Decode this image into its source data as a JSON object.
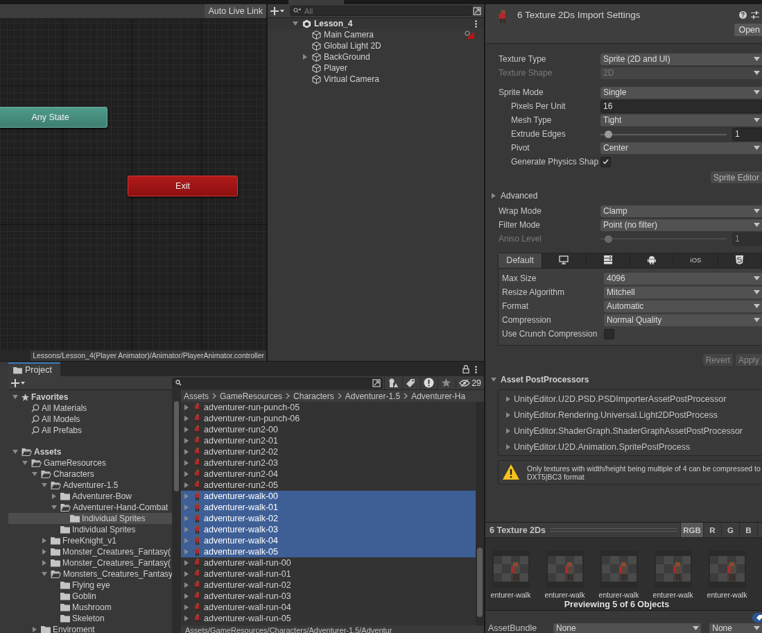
{
  "animator": {
    "toolbar_button": "Auto Live Link",
    "nodes": [
      {
        "label": "Any State",
        "kind": "any_state"
      },
      {
        "label": "Exit",
        "kind": "exit"
      }
    ],
    "path": "Lessons/Lesson_4(Player Animator)/Animator/PlayerAnimator.controller"
  },
  "hierarchy": {
    "search": {
      "placeholder": "All"
    },
    "scene": {
      "label": "Lesson_4",
      "expanded": true
    },
    "items": [
      {
        "label": "Main Camera",
        "expandable": false,
        "alert": true
      },
      {
        "label": "Global Light 2D",
        "expandable": false,
        "alert": false
      },
      {
        "label": "BackGround",
        "expandable": true,
        "alert": false
      },
      {
        "label": "Player",
        "expandable": false,
        "alert": false
      },
      {
        "label": "Virtual Camera",
        "expandable": false,
        "alert": false
      }
    ]
  },
  "inspector": {
    "title": "6 Texture 2Ds Import Settings",
    "open_button": "Open",
    "texture_rows": [
      {
        "label": "Texture Type",
        "kind": "dropdown",
        "value": "Sprite (2D and UI)",
        "disabled": false
      },
      {
        "label": "Texture Shape",
        "kind": "dropdown",
        "value": "2D",
        "disabled": true
      }
    ],
    "sprite_rows": [
      {
        "label": "Sprite Mode",
        "kind": "dropdown",
        "value": "Single",
        "disabled": false,
        "children": [
          {
            "label": "Pixels Per Unit",
            "kind": "number",
            "value": "16",
            "disabled": false
          },
          {
            "label": "Mesh Type",
            "kind": "dropdown",
            "value": "Tight",
            "disabled": false
          },
          {
            "label": "Extrude Edges",
            "kind": "slider",
            "level": 0.06,
            "value": "1",
            "disabled": false
          },
          {
            "label": "Pivot",
            "kind": "dropdown",
            "value": "Center",
            "disabled": false
          },
          {
            "label": "Generate Physics Shap",
            "kind": "checkbox",
            "checked": true,
            "disabled": false
          }
        ]
      }
    ],
    "sprite_editor_button": "Sprite Editor",
    "advanced": {
      "label": "Advanced",
      "expanded": false
    },
    "sampling_rows": [
      {
        "label": "Wrap Mode",
        "kind": "dropdown",
        "value": "Clamp",
        "disabled": false
      },
      {
        "label": "Filter Mode",
        "kind": "dropdown",
        "value": "Point (no filter)",
        "disabled": false
      },
      {
        "label": "Aniso Level",
        "kind": "slider",
        "level": 0.06,
        "value": "1",
        "disabled": true
      }
    ],
    "platform_tabs": [
      {
        "kind": "text",
        "label": "Default",
        "selected": true
      },
      {
        "kind": "monitor",
        "selected": false
      },
      {
        "kind": "server",
        "selected": false
      },
      {
        "kind": "android",
        "selected": false
      },
      {
        "kind": "text",
        "label": "iOS",
        "selected": false
      },
      {
        "kind": "html5",
        "selected": false
      }
    ],
    "platform_rows": [
      {
        "label": "Max Size",
        "kind": "dropdown",
        "value": "4096",
        "disabled": false
      },
      {
        "label": "Resize Algorithm",
        "kind": "dropdown",
        "value": "Mitchell",
        "disabled": false
      },
      {
        "label": "Format",
        "kind": "dropdown",
        "value": "Automatic",
        "disabled": false
      },
      {
        "label": "Compression",
        "kind": "dropdown",
        "value": "Normal Quality",
        "disabled": false
      },
      {
        "label": "Use Crunch Compression",
        "kind": "checkbox",
        "checked": false,
        "disabled": false
      }
    ],
    "revert_button": {
      "label": "Revert",
      "disabled": true
    },
    "apply_button": {
      "label": "Apply",
      "disabled": true
    },
    "postprocessors": {
      "label": "Asset PostProcessors",
      "expanded": true,
      "items": [
        "UnityEditor.U2D.PSD.PSDImporterAssetPostProcessor",
        "UnityEditor.Rendering.Universal.Light2DPostProcess",
        "UnityEditor.ShaderGraph.ShaderGraphAssetPostProcessor",
        "UnityEditor.U2D.Animation.SpritePostProcess"
      ]
    },
    "warning": "Only textures with width/height being multiple of 4 can be compressed to DXT5|BC3 format",
    "preview": {
      "title": "6 Texture 2Ds",
      "channels": [
        {
          "label": "RGB",
          "selected": true
        },
        {
          "label": "R",
          "selected": false
        },
        {
          "label": "G",
          "selected": false
        },
        {
          "label": "B",
          "selected": false
        }
      ],
      "thumbnails": [
        {
          "label": "enturer-walk"
        },
        {
          "label": "enturer-walk"
        },
        {
          "label": "enturer-walk"
        },
        {
          "label": "enturer-walk"
        },
        {
          "label": "enturer-walk"
        }
      ],
      "caption": "Previewing 5 of 6 Objects"
    },
    "asset_bundle": {
      "label": "AssetBundle",
      "values": [
        "None",
        "None"
      ]
    }
  },
  "project": {
    "tab": "Project",
    "hidden_count": "29",
    "tree": [
      {
        "label": "Favorites",
        "kind": "favorites",
        "expandable": true,
        "expanded": true,
        "selected": false,
        "children": [
          {
            "label": "All Materials",
            "kind": "search",
            "expandable": false,
            "selected": false
          },
          {
            "label": "All Models",
            "kind": "search",
            "expandable": false,
            "selected": false
          },
          {
            "label": "All Prefabs",
            "kind": "search",
            "expandable": false,
            "selected": false
          }
        ]
      },
      {
        "label": "Assets",
        "kind": "folder",
        "expandable": true,
        "expanded": true,
        "selected": false,
        "children": [
          {
            "label": "GameResources",
            "kind": "folder",
            "expandable": true,
            "expanded": true,
            "selected": false,
            "children": [
              {
                "label": "Characters",
                "kind": "folder",
                "expandable": true,
                "expanded": true,
                "selected": false,
                "children": [
                  {
                    "label": "Adventurer-1.5",
                    "kind": "folder",
                    "expandable": true,
                    "expanded": true,
                    "selected": false,
                    "children": [
                      {
                        "label": "Adventurer-Bow",
                        "kind": "folder",
                        "expandable": true,
                        "expanded": false,
                        "selected": false
                      },
                      {
                        "label": "Adventurer-Hand-Combat",
                        "kind": "folder",
                        "expandable": true,
                        "expanded": true,
                        "selected": false,
                        "children": [
                          {
                            "label": "Individual Sprites",
                            "kind": "folder",
                            "expandable": false,
                            "selected": true
                          }
                        ]
                      },
                      {
                        "label": "Individual Sprites",
                        "kind": "folder",
                        "expandable": false,
                        "selected": false
                      }
                    ]
                  },
                  {
                    "label": "FreeKnight_v1",
                    "kind": "folder",
                    "expandable": true,
                    "expanded": false,
                    "selected": false
                  },
                  {
                    "label": "Monster_Creatures_Fantasy(",
                    "kind": "folder",
                    "expandable": true,
                    "expanded": false,
                    "selected": false
                  },
                  {
                    "label": "Monster_Creatures_Fantasy(",
                    "kind": "folder",
                    "expandable": true,
                    "expanded": false,
                    "selected": false
                  },
                  {
                    "label": "Monsters_Creatures_Fantasy",
                    "kind": "folder",
                    "expandable": true,
                    "expanded": true,
                    "selected": false,
                    "children": [
                      {
                        "label": "Flying eye",
                        "kind": "folder",
                        "expandable": false,
                        "selected": false
                      },
                      {
                        "label": "Goblin",
                        "kind": "folder",
                        "expandable": false,
                        "selected": false
                      },
                      {
                        "label": "Mushroom",
                        "kind": "folder",
                        "expandable": false,
                        "selected": false
                      },
                      {
                        "label": "Skeleton",
                        "kind": "folder",
                        "expandable": false,
                        "selected": false
                      }
                    ]
                  }
                ]
              },
              {
                "label": "Enviroment",
                "kind": "folder",
                "expandable": true,
                "expanded": false,
                "selected": false
              }
            ]
          }
        ]
      }
    ],
    "breadcrumb": [
      "Assets",
      "GameResources",
      "Characters",
      "Adventurer-1.5",
      "Adventurer-Ha"
    ],
    "files": [
      {
        "label": "adventurer-run-punch-05",
        "selected": false
      },
      {
        "label": "adventurer-run-punch-06",
        "selected": false
      },
      {
        "label": "adventurer-run2-00",
        "selected": false
      },
      {
        "label": "adventurer-run2-01",
        "selected": false
      },
      {
        "label": "adventurer-run2-02",
        "selected": false
      },
      {
        "label": "adventurer-run2-03",
        "selected": false
      },
      {
        "label": "adventurer-run2-04",
        "selected": false
      },
      {
        "label": "adventurer-run2-05",
        "selected": false
      },
      {
        "label": "adventurer-walk-00",
        "selected": true
      },
      {
        "label": "adventurer-walk-01",
        "selected": true
      },
      {
        "label": "adventurer-walk-02",
        "selected": true
      },
      {
        "label": "adventurer-walk-03",
        "selected": true
      },
      {
        "label": "adventurer-walk-04",
        "selected": true
      },
      {
        "label": "adventurer-walk-05",
        "selected": true
      },
      {
        "label": "adventurer-wall-run-00",
        "selected": false
      },
      {
        "label": "adventurer-wall-run-01",
        "selected": false
      },
      {
        "label": "adventurer-wall-run-02",
        "selected": false
      },
      {
        "label": "adventurer-wall-run-03",
        "selected": false
      },
      {
        "label": "adventurer-wall-run-04",
        "selected": false
      },
      {
        "label": "adventurer-wall-run-05",
        "selected": false
      }
    ],
    "path": "Assets/GameResources/Characters/Adventurer-1.5/Adventur"
  }
}
